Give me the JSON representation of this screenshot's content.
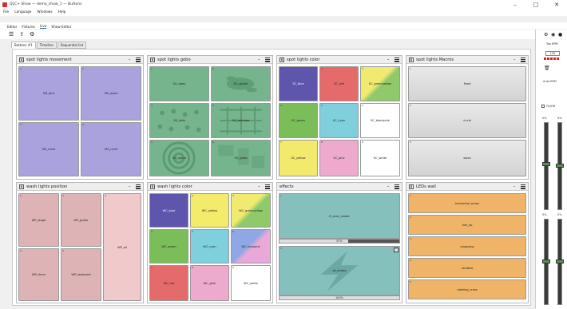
{
  "window": {
    "title": "QLC+ Show — demo_show_1 — Buttons",
    "controls": [
      "–",
      "□",
      "✕"
    ]
  },
  "menubar": [
    "File",
    "Language",
    "Windows",
    "Help"
  ],
  "top_tabs": [
    "Editor",
    "Fixtures",
    "Live",
    "Show Editor"
  ],
  "toolbar_icons": [
    "grid-icon",
    "share-icon",
    "settings-icon"
  ],
  "page_tabs": [
    "Buttons #1",
    "Timeline",
    "Sequential list"
  ],
  "frames": {
    "movement": {
      "title": "spot lights movement",
      "cap": "S",
      "buttons": [
        {
          "n": "1",
          "label": "SM_bird"
        },
        {
          "n": "2",
          "label": "SM_wave"
        },
        {
          "n": "3",
          "label": "SM_circle"
        },
        {
          "n": "4",
          "label": "SM_circle"
        }
      ]
    },
    "gobo": {
      "title": "spot lights gobo",
      "cap": "S",
      "buttons": [
        {
          "n": "1",
          "label": "SG_open"
        },
        {
          "n": "2",
          "label": "SG_splash"
        },
        {
          "n": "3",
          "label": "SG_dots"
        },
        {
          "n": "4",
          "label": "SG_bamboo"
        },
        {
          "n": "5",
          "label": "SG_spiral"
        },
        {
          "n": "6",
          "label": "SG_glass"
        }
      ]
    },
    "color": {
      "title": "spot lights color",
      "cap": "S",
      "buttons": [
        {
          "n": "1",
          "label": "SC_blue",
          "color": "#5e55ad"
        },
        {
          "n": "2",
          "label": "SC_red",
          "color": "#e56a6a"
        },
        {
          "n": "3",
          "label": "SC_greenyellow",
          "color": "#ffffff"
        },
        {
          "n": "4",
          "label": "SC_green",
          "color": "#7bbd58"
        },
        {
          "n": "5",
          "label": "SC_cyan",
          "color": "#7fd0dc"
        },
        {
          "n": "6",
          "label": "SC_blackpink",
          "color": "#ffffff"
        },
        {
          "n": "7",
          "label": "SC_yellow",
          "color": "#f2ea6c"
        },
        {
          "n": "8",
          "label": "SC_pink",
          "color": "#eeaacc"
        },
        {
          "n": "9",
          "label": "SC_white",
          "color": "#ffffff"
        }
      ]
    },
    "macros": {
      "title": "spot lights Macros",
      "cap": "S",
      "buttons": [
        {
          "n": "1",
          "label": "fixed"
        },
        {
          "n": "2",
          "label": "circle"
        },
        {
          "n": "3",
          "label": "wave"
        }
      ]
    },
    "wpos": {
      "title": "wash lights position",
      "cap": "S",
      "buttons": [
        {
          "n": "1",
          "label": "WP_stage"
        },
        {
          "n": "2",
          "label": "WP_guitar"
        },
        {
          "n": "3",
          "label": "WP_all"
        },
        {
          "n": "4",
          "label": "WP_drum"
        },
        {
          "n": "5",
          "label": "WP_keyboard"
        }
      ]
    },
    "wcolor": {
      "title": "wash lights color",
      "cap": "S",
      "buttons": [
        {
          "n": "1",
          "label": "WC_blue",
          "color": "#5e55ad"
        },
        {
          "n": "2",
          "label": "WC_yellow",
          "color": "#f3eb6a"
        },
        {
          "n": "3",
          "label": "WC_greenyellow",
          "color": "#c6de7c"
        },
        {
          "n": "4",
          "label": "WC_green",
          "color": "#7bbd58"
        },
        {
          "n": "5",
          "label": "WC_cyan",
          "color": "#7fd0dc"
        },
        {
          "n": "6",
          "label": "WC_bluepink",
          "color": "#a9a6e6"
        },
        {
          "n": "7",
          "label": "WC_red",
          "color": "#e56a6a"
        },
        {
          "n": "8",
          "label": "WC_pink",
          "color": "#eeaacc"
        },
        {
          "n": "9",
          "label": "WC_white",
          "color": "#ffffff"
        }
      ]
    },
    "effects": {
      "title": "effects",
      "cap": "",
      "buttons": [
        {
          "n": "1",
          "label": "E_color_rotate",
          "progress_text": "57%",
          "progress": 0.57
        },
        {
          "n": "2",
          "label": "all_strobe",
          "progress_text": "100%",
          "progress": 1.0,
          "badge": "T"
        }
      ]
    },
    "wall": {
      "title": "LEDs wall",
      "cap": "S",
      "buttons": [
        {
          "n": "1",
          "label": "horizontal_arrow"
        },
        {
          "n": "2",
          "label": "line_up"
        },
        {
          "n": "3",
          "label": "pingpong"
        },
        {
          "n": "4",
          "label": "rainbow"
        },
        {
          "n": "5",
          "label": "rotating_cross"
        }
      ]
    }
  },
  "sidepanel": {
    "tap_label": "Tap BPM",
    "tempo": "120",
    "bpm_label": "Auto BPM",
    "onoff": "On/Off",
    "left_pct": "0%",
    "right_pct": "0%",
    "left_pct2": "0%",
    "right_pct2": "0%",
    "fader_left": "Grand Master",
    "fader_right": "Grand Master"
  }
}
